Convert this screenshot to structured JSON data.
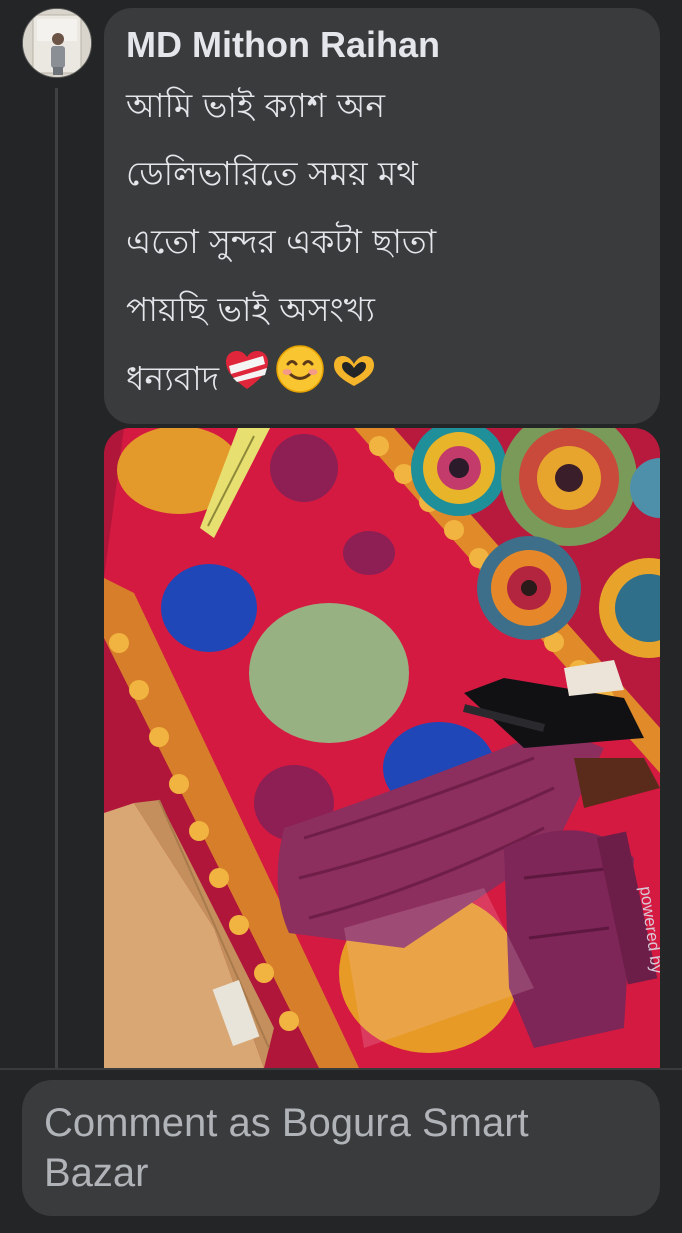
{
  "comment": {
    "author": "MD Mithon Raihan",
    "lines": [
      "আমি ভাই ক্যাশ অন",
      "ডেলিভারিতে সময় মথ",
      "এতো সুন্দর একটা ছাতা",
      "পায়ছি ভাই অসংখ্য",
      "ধন্যবাদ"
    ],
    "emojis": [
      "mending-heart-icon",
      "smiling-face-icon",
      "heart-hands-icon"
    ]
  },
  "photo": {
    "overlay_text": "powered by"
  },
  "composer": {
    "placeholder": "Comment as Bogura Smart Bazar"
  },
  "colors": {
    "background": "#242526",
    "bubble": "#3a3b3c",
    "text": "#e4e6eb",
    "muted": "#b0b3b8",
    "mat_red": "#c8193a"
  }
}
